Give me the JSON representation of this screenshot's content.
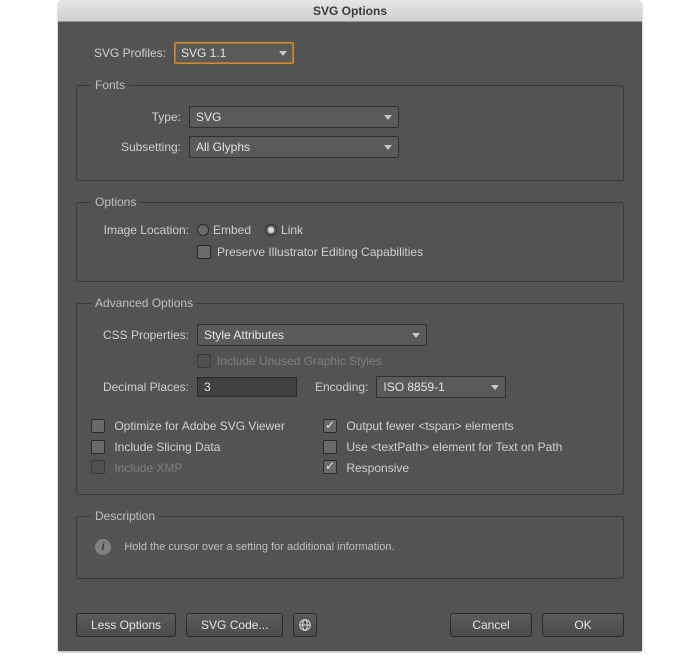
{
  "title": "SVG Options",
  "profile": {
    "label": "SVG Profiles:",
    "value": "SVG 1.1"
  },
  "fonts": {
    "legend": "Fonts",
    "type": {
      "label": "Type:",
      "value": "SVG"
    },
    "subsetting": {
      "label": "Subsetting:",
      "value": "All Glyphs"
    }
  },
  "options": {
    "legend": "Options",
    "imageLocation": {
      "label": "Image Location:",
      "embed": "Embed",
      "link": "Link",
      "selected": "link"
    },
    "preserve": "Preserve Illustrator Editing Capabilities"
  },
  "advanced": {
    "legend": "Advanced Options",
    "css": {
      "label": "CSS Properties:",
      "value": "Style Attributes"
    },
    "includeUnused": "Include Unused Graphic Styles",
    "decimal": {
      "label": "Decimal Places:",
      "value": "3"
    },
    "encoding": {
      "label": "Encoding:",
      "value": "ISO 8859-1"
    },
    "cbs": {
      "optimize": "Optimize for Adobe SVG Viewer",
      "slicing": "Include Slicing Data",
      "xmp": "Include XMP",
      "tspan": "Output fewer <tspan> elements",
      "textpath": "Use <textPath> element for Text on Path",
      "responsive": "Responsive"
    }
  },
  "description": {
    "legend": "Description",
    "text": "Hold the cursor over a setting for additional information."
  },
  "footer": {
    "less": "Less Options",
    "svgcode": "SVG Code...",
    "cancel": "Cancel",
    "ok": "OK"
  }
}
